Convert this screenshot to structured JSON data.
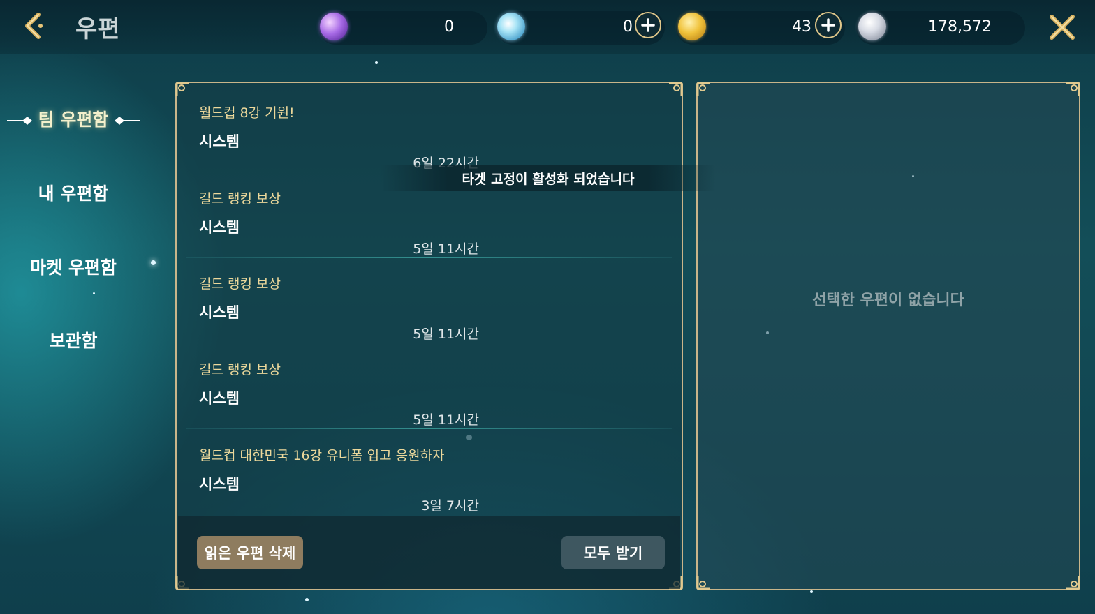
{
  "header": {
    "title": "우편",
    "back_icon": "chevron-left-icon",
    "close_icon": "close-icon"
  },
  "currencies": [
    {
      "name": "purple-gem",
      "icon": "purple-gem-icon",
      "value": "0",
      "color": "#9b6be0"
    },
    {
      "name": "blue-crystal",
      "icon": "blue-crystal-icon",
      "value": "0",
      "color": "#6fc3e8"
    },
    {
      "name": "gold-coin",
      "icon": "gold-coin-icon",
      "value": "43",
      "color": "#e6b43a"
    },
    {
      "name": "silver-coin",
      "icon": "silver-coin-icon",
      "value": "178,572",
      "color": "#c8ccd6"
    }
  ],
  "sidebar": {
    "items": [
      {
        "label": "팀 우편함",
        "active": true
      },
      {
        "label": "내 우편함",
        "active": false
      },
      {
        "label": "마켓 우편함",
        "active": false
      },
      {
        "label": "보관함",
        "active": false
      }
    ]
  },
  "mail_list": [
    {
      "title": "월드컵 8강 기원!",
      "sender": "시스템",
      "time": "6일 22시간"
    },
    {
      "title": "길드 랭킹 보상",
      "sender": "시스템",
      "time": "5일 11시간"
    },
    {
      "title": "길드 랭킹 보상",
      "sender": "시스템",
      "time": "5일 11시간"
    },
    {
      "title": "길드 랭킹 보상",
      "sender": "시스템",
      "time": "5일 11시간"
    },
    {
      "title": "월드컵 대한민국 16강 유니폼 입고 응원하자",
      "sender": "시스템",
      "time": "3일 7시간"
    }
  ],
  "footer": {
    "delete_read_label": "읽은 우편 삭제",
    "receive_all_label": "모두 받기"
  },
  "toast": "타겟 고정이 활성화 되었습니다",
  "detail": {
    "empty_message": "선택한 우편이 없습니다"
  },
  "colors": {
    "frame_gold": "#c9b58a",
    "mail_title": "#ecd89b",
    "delete_button": "#8e7c5f",
    "receive_button": "#3e5760"
  }
}
